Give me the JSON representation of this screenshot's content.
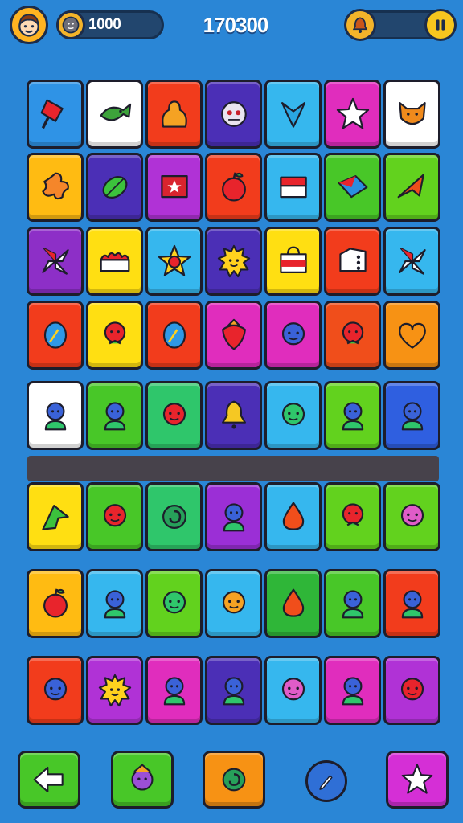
{
  "hud": {
    "coins": "1000",
    "score": "170300",
    "icons": {
      "avatar": "player-avatar-icon",
      "coin": "coin-icon",
      "boost": "bell-icon",
      "pause": "pause-icon"
    }
  },
  "board": {
    "rows": [
      [
        {
          "color": "#2f93e6",
          "icon": "popsicle"
        },
        {
          "color": "#ffffff",
          "icon": "fish"
        },
        {
          "color": "#f23c1c",
          "icon": "blob"
        },
        {
          "color": "#4b2fb6",
          "icon": "monster"
        },
        {
          "color": "#36b7ee",
          "icon": "arrow-down"
        },
        {
          "color": "#e02dbd",
          "icon": "star"
        },
        {
          "color": "#ffffff",
          "icon": "cat"
        }
      ],
      [
        {
          "color": "#ffbb12",
          "icon": "flower"
        },
        {
          "color": "#4b2fb6",
          "icon": "leaf"
        },
        {
          "color": "#b032d6",
          "icon": "flag-star"
        },
        {
          "color": "#f23c1c",
          "icon": "apple"
        },
        {
          "color": "#36b7ee",
          "icon": "box"
        },
        {
          "color": "#48c728",
          "icon": "kite"
        },
        {
          "color": "#62d21e",
          "icon": "plane"
        }
      ],
      [
        {
          "color": "#8d2fc7",
          "icon": "pinwheel"
        },
        {
          "color": "#ffdf12",
          "icon": "cake"
        },
        {
          "color": "#36b7ee",
          "icon": "star-ball"
        },
        {
          "color": "#4b2fb6",
          "icon": "sun-face"
        },
        {
          "color": "#ffdf12",
          "icon": "bag"
        },
        {
          "color": "#f23c1c",
          "icon": "dice"
        },
        {
          "color": "#36b7ee",
          "icon": "pinwheel"
        }
      ],
      [
        {
          "color": "#f23c1c",
          "icon": "egg"
        },
        {
          "color": "#ffdf12",
          "icon": "rose"
        },
        {
          "color": "#f23c1c",
          "icon": "egg"
        },
        {
          "color": "#e02dbd",
          "icon": "strawberry"
        },
        {
          "color": "#e02dbd",
          "icon": "face"
        },
        {
          "color": "#f04e1b",
          "icon": "rose"
        },
        {
          "color": "#f79214",
          "icon": "heart"
        }
      ],
      [
        {
          "color": "#ffffff",
          "icon": "person"
        },
        {
          "color": "#48c728",
          "icon": "person"
        },
        {
          "color": "#2fc66b",
          "icon": "face"
        },
        {
          "color": "#4b2fb6",
          "icon": "bell"
        },
        {
          "color": "#36b7ee",
          "icon": "face"
        },
        {
          "color": "#62d21e",
          "icon": "person"
        },
        {
          "color": "#2f5fe0",
          "icon": "person"
        }
      ],
      [
        {
          "color": "#ffdf12",
          "icon": "arrow"
        },
        {
          "color": "#48c728",
          "icon": "face"
        },
        {
          "color": "#2fc66b",
          "icon": "swirl"
        },
        {
          "color": "#9b2fd6",
          "icon": "person"
        },
        {
          "color": "#36b7ee",
          "icon": "drop"
        },
        {
          "color": "#62d21e",
          "icon": "rose"
        },
        {
          "color": "#62d21e",
          "icon": "face"
        }
      ],
      [
        {
          "color": "#ffbb12",
          "icon": "apple"
        },
        {
          "color": "#36b7ee",
          "icon": "person"
        },
        {
          "color": "#62d21e",
          "icon": "face"
        },
        {
          "color": "#36b7ee",
          "icon": "face"
        },
        {
          "color": "#2fb638",
          "icon": "drop"
        },
        {
          "color": "#48c728",
          "icon": "person"
        },
        {
          "color": "#f23c1c",
          "icon": "person"
        }
      ],
      [
        {
          "color": "#f23c1c",
          "icon": "face"
        },
        {
          "color": "#b032d6",
          "icon": "sun-face"
        },
        {
          "color": "#e02dbd",
          "icon": "person"
        },
        {
          "color": "#4b2fb6",
          "icon": "person"
        },
        {
          "color": "#36b7ee",
          "icon": "face"
        },
        {
          "color": "#e02dbd",
          "icon": "person"
        },
        {
          "color": "#b032d6",
          "icon": "face"
        }
      ]
    ]
  },
  "toolbar": {
    "buttons": [
      {
        "name": "back-button",
        "icon": "arrow-left-icon",
        "color": "#48c728"
      },
      {
        "name": "character-button",
        "icon": "character-icon",
        "color": "#48c728"
      },
      {
        "name": "shuffle-button",
        "icon": "swirl-icon",
        "color": "#f79214"
      },
      {
        "name": "hint-button",
        "icon": "pencil-icon",
        "color": "#2f6fd6"
      },
      {
        "name": "star-button",
        "icon": "star-icon",
        "color": "#d52fd6"
      }
    ]
  }
}
